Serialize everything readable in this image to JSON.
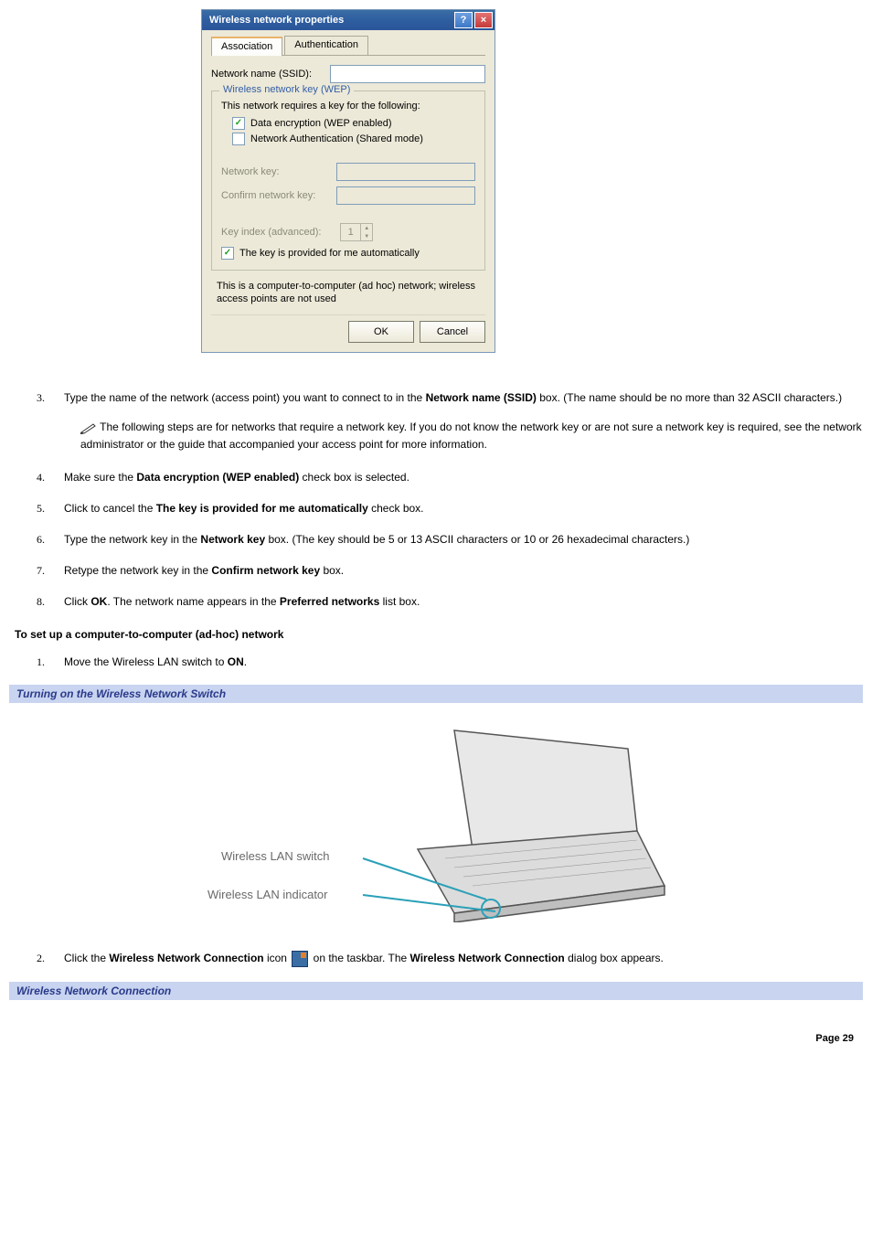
{
  "dialog": {
    "title": "Wireless network properties",
    "tabs": {
      "association": "Association",
      "authentication": "Authentication"
    },
    "ssid_label": "Network name (SSID):",
    "group_legend": "Wireless network key (WEP)",
    "group_text": "This network requires a key for the following:",
    "cb_encryption": "Data encryption (WEP enabled)",
    "cb_auth": "Network Authentication (Shared mode)",
    "network_key_label": "Network key:",
    "confirm_key_label": "Confirm network key:",
    "key_index_label": "Key index (advanced):",
    "key_index_value": "1",
    "cb_auto_key": "The key is provided for me automatically",
    "cb_adhoc": "This is a computer-to-computer (ad hoc) network; wireless access points are not used",
    "ok": "OK",
    "cancel": "Cancel"
  },
  "stepsA": {
    "s3a": "Type the name of the network (access point) you want to connect to in the ",
    "s3b": "Network name (SSID)",
    "s3c": " box. (The name should be no more than 32 ASCII characters.)",
    "note": " The following steps are for networks that require a network key. If you do not know the network key or are not sure a network key is required, see the network administrator or the guide that accompanied your access point for more information.",
    "s4a": "Make sure the ",
    "s4b": "Data encryption (WEP enabled)",
    "s4c": " check box is selected.",
    "s5a": "Click to cancel the ",
    "s5b": "The key is provided for me automatically",
    "s5c": " check box.",
    "s6a": "Type the network key in the ",
    "s6b": "Network key",
    "s6c": " box. (The key should be 5 or 13 ASCII characters or 10 or 26 hexadecimal characters.)",
    "s7a": "Retype the network key in the ",
    "s7b": "Confirm network key",
    "s7c": " box.",
    "s8a": "Click ",
    "s8b": "OK",
    "s8c": ". The network name appears in the ",
    "s8d": "Preferred networks",
    "s8e": " list box."
  },
  "headings": {
    "adhoc": "To set up a computer-to-computer (ad-hoc) network",
    "caption1": "Turning on the Wireless Network Switch",
    "caption2": "Wireless Network Connection"
  },
  "stepsB": {
    "s1a": "Move the Wireless LAN switch to ",
    "s1b": "ON",
    "s1c": ".",
    "s2a": "Click the ",
    "s2b": "Wireless Network Connection",
    "s2c": " icon ",
    "s2d": " on the taskbar. The ",
    "s2e": "Wireless Network Connection",
    "s2f": " dialog box appears."
  },
  "illustration": {
    "switch_label": "Wireless LAN switch",
    "indicator_label": "Wireless LAN indicator"
  },
  "footer": "Page 29"
}
